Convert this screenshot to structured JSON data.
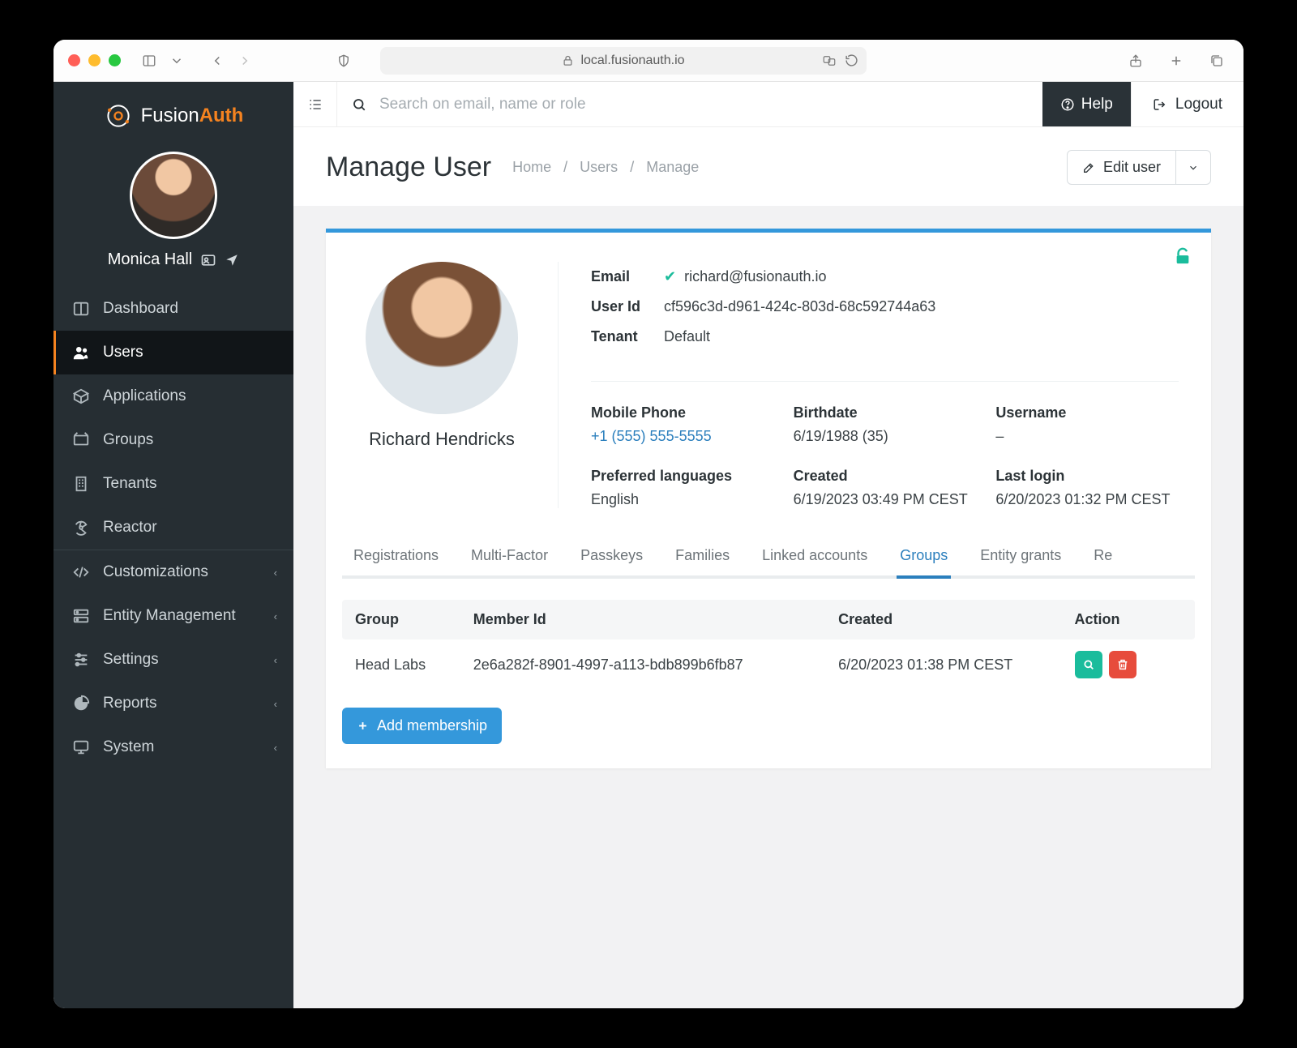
{
  "browser": {
    "url": "local.fusionauth.io"
  },
  "brand": {
    "name_part1": "Fusion",
    "name_part2": "Auth"
  },
  "current_user": {
    "name": "Monica Hall"
  },
  "sidebar": {
    "items": [
      {
        "label": "Dashboard"
      },
      {
        "label": "Users"
      },
      {
        "label": "Applications"
      },
      {
        "label": "Groups"
      },
      {
        "label": "Tenants"
      },
      {
        "label": "Reactor"
      },
      {
        "label": "Customizations"
      },
      {
        "label": "Entity Management"
      },
      {
        "label": "Settings"
      },
      {
        "label": "Reports"
      },
      {
        "label": "System"
      }
    ]
  },
  "toolbar": {
    "search_placeholder": "Search on email, name or role",
    "help": "Help",
    "logout": "Logout"
  },
  "page": {
    "title": "Manage User",
    "breadcrumb": {
      "home": "Home",
      "users": "Users",
      "manage": "Manage",
      "sep": "/"
    },
    "edit_user": "Edit user"
  },
  "user": {
    "name": "Richard Hendricks",
    "labels": {
      "email": "Email",
      "user_id": "User Id",
      "tenant": "Tenant"
    },
    "email": "richard@fusionauth.io",
    "user_id": "cf596c3d-d961-424c-803d-68c592744a63",
    "tenant": "Default",
    "grid": {
      "mobile_phone": {
        "label": "Mobile Phone",
        "value": "+1 (555) 555-5555"
      },
      "birthdate": {
        "label": "Birthdate",
        "value": "6/19/1988 (35)"
      },
      "username": {
        "label": "Username",
        "value": "–"
      },
      "preferred_languages": {
        "label": "Preferred languages",
        "value": "English"
      },
      "created": {
        "label": "Created",
        "value": "6/19/2023 03:49 PM CEST"
      },
      "last_login": {
        "label": "Last login",
        "value": "6/20/2023 01:32 PM CEST"
      }
    }
  },
  "tabs": [
    "Registrations",
    "Multi-Factor",
    "Passkeys",
    "Families",
    "Linked accounts",
    "Groups",
    "Entity grants",
    "Re"
  ],
  "groups_table": {
    "headers": {
      "group": "Group",
      "member_id": "Member Id",
      "created": "Created",
      "action": "Action"
    },
    "rows": [
      {
        "group": "Head Labs",
        "member_id": "2e6a282f-8901-4997-a113-bdb899b6fb87",
        "created": "6/20/2023 01:38 PM CEST"
      }
    ],
    "add_label": "Add membership"
  }
}
